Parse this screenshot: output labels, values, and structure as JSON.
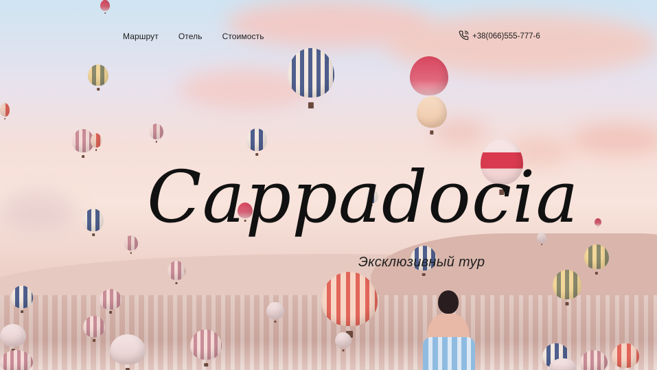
{
  "nav": {
    "items": [
      {
        "label": "Маршрут"
      },
      {
        "label": "Отель"
      },
      {
        "label": "Стоимость"
      }
    ]
  },
  "contact": {
    "phone": "+38(066)555-777-6",
    "icon": "phone-icon"
  },
  "hero": {
    "title": "Cappadocia",
    "subtitle": "Эксклюзивный тур"
  },
  "colors": {
    "text": "#1b1b1b",
    "sky_top": "#cfe4f2",
    "sky_mid": "#f6dfd9"
  }
}
